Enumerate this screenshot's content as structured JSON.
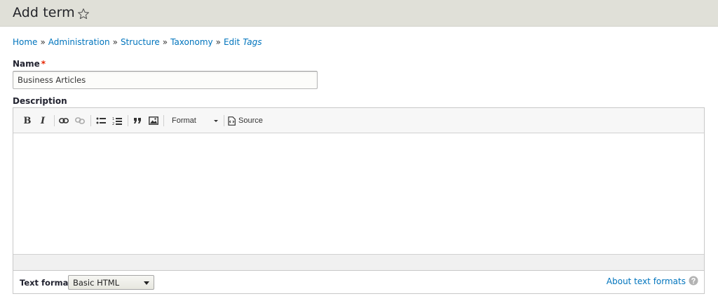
{
  "header": {
    "title": "Add term"
  },
  "breadcrumb": {
    "items": [
      "Home",
      "Administration",
      "Structure",
      "Taxonomy",
      "Edit"
    ],
    "emphasis": "Tags",
    "separator": "»"
  },
  "name_field": {
    "label": "Name",
    "required_mark": "*",
    "value": "Business Articles"
  },
  "description": {
    "label": "Description",
    "toolbar": {
      "bold": "B",
      "italic": "I",
      "format_label": "Format",
      "source_label": "Source"
    }
  },
  "text_format": {
    "label": "Text format",
    "selected": "Basic HTML",
    "about_link": "About text formats"
  },
  "colors": {
    "link": "#0074bd",
    "required": "#e62600",
    "header_bg": "#e0e0d8"
  }
}
